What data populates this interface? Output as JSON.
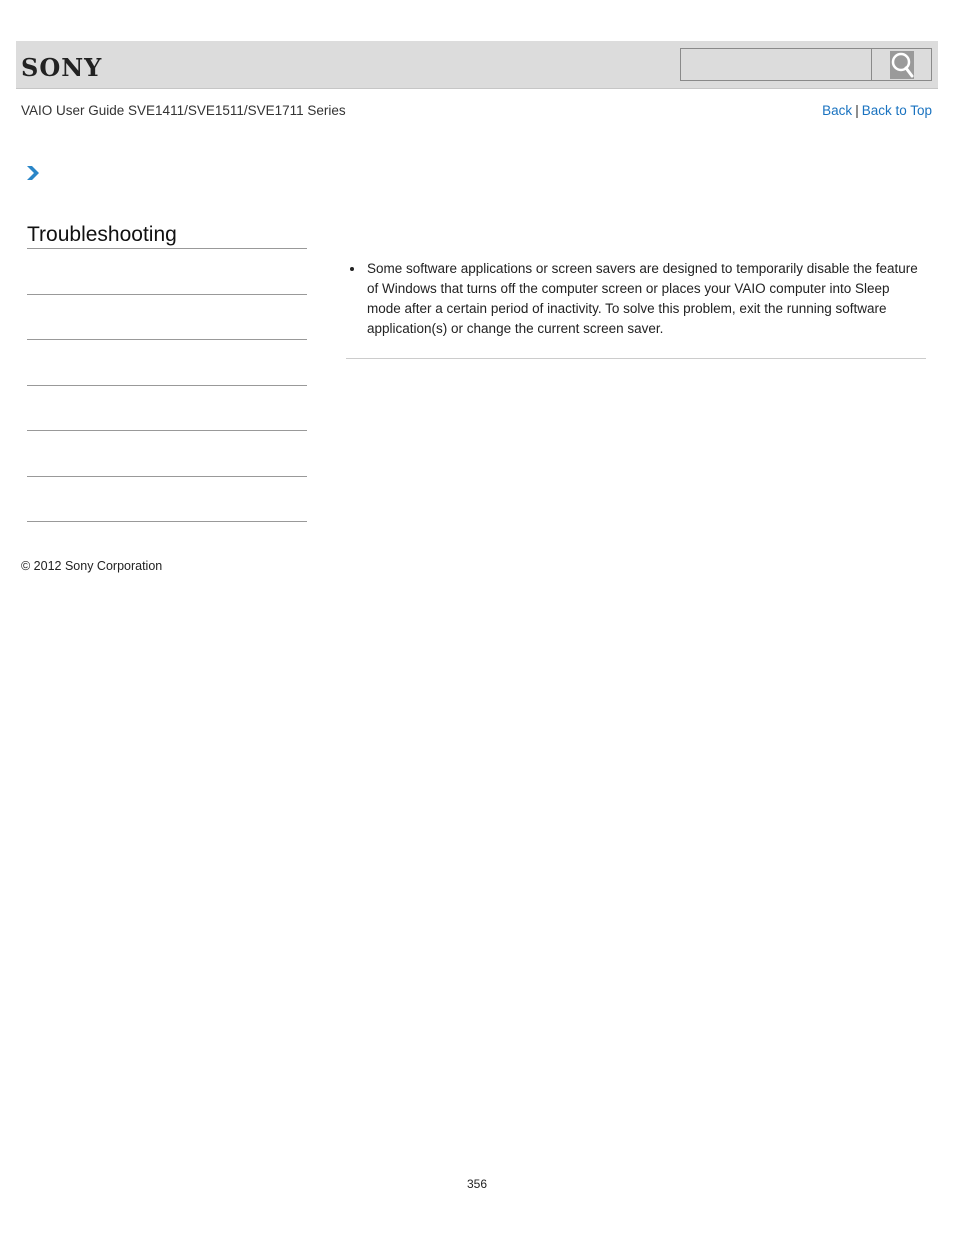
{
  "header": {
    "logo": "SONY",
    "search": {
      "value": "",
      "placeholder": ""
    },
    "search_button_icon": "search-icon"
  },
  "subheader": {
    "guide_title": "VAIO User Guide SVE1411/SVE1511/SVE1711 Series",
    "back_label": "Back",
    "separator": "|",
    "back_to_top_label": "Back to Top"
  },
  "breadcrumb": {
    "icon": "chevron-right-icon"
  },
  "sidebar": {
    "title": "Troubleshooting",
    "items": [
      "",
      "",
      "",
      "",
      "",
      ""
    ]
  },
  "content": {
    "bullets": [
      "Some software applications or screen savers are designed to temporarily disable the feature of Windows that turns off the computer screen or places your VAIO computer into Sleep mode after a certain period of inactivity. To solve this problem, exit the running software application(s) or change the current screen saver."
    ]
  },
  "footer": {
    "copyright": "© 2012 Sony Corporation",
    "page_number": "356"
  },
  "colors": {
    "header_bg": "#dcdcdc",
    "link": "#1a73c0",
    "chevron": "#2a86c8"
  }
}
